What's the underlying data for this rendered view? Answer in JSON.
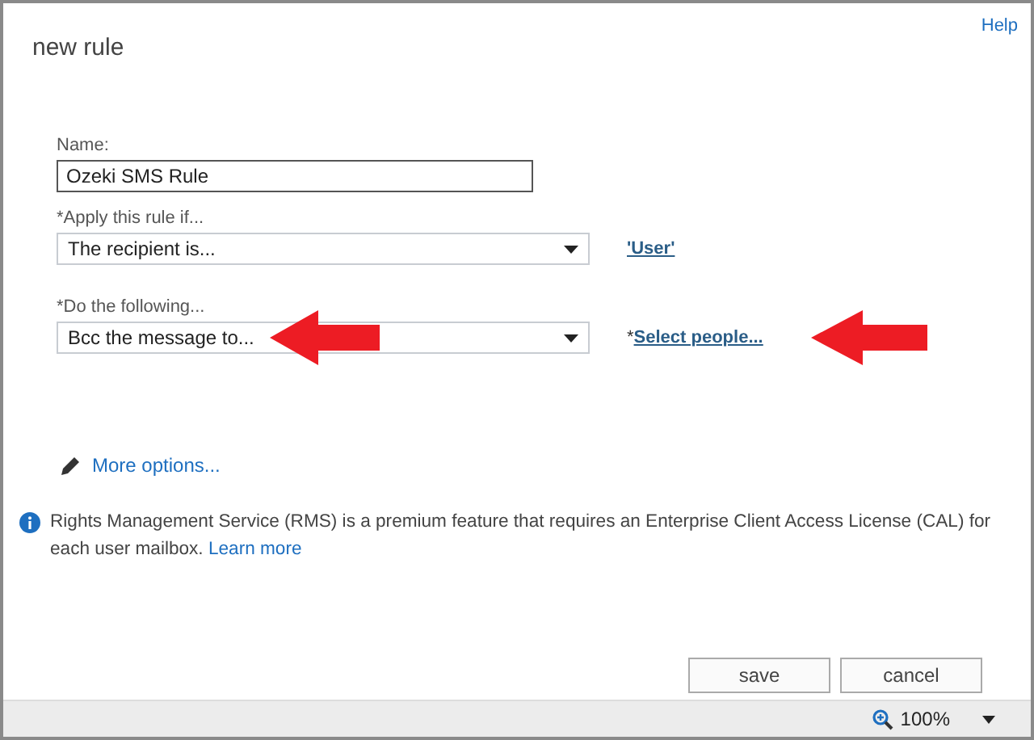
{
  "window": {
    "title": "new rule",
    "help": "Help"
  },
  "name_field": {
    "label": "Name:",
    "value": "Ozeki SMS Rule"
  },
  "rules": [
    {
      "label": "*Apply this rule if...",
      "value": "The recipient is...",
      "link": "'User'",
      "marked": false
    },
    {
      "label": "*Do the following...",
      "value": "Bcc the message to...",
      "link_prefix": "*",
      "link": "Select people...",
      "marked": true
    }
  ],
  "more_options": "More options...",
  "info": {
    "text": "Rights Management Service (RMS) is a premium feature that requires an Enterprise Client Access License (CAL) for each user mailbox.",
    "link": "Learn more"
  },
  "buttons": [
    "save",
    "cancel"
  ],
  "status_bar": {
    "zoom": "100%"
  }
}
